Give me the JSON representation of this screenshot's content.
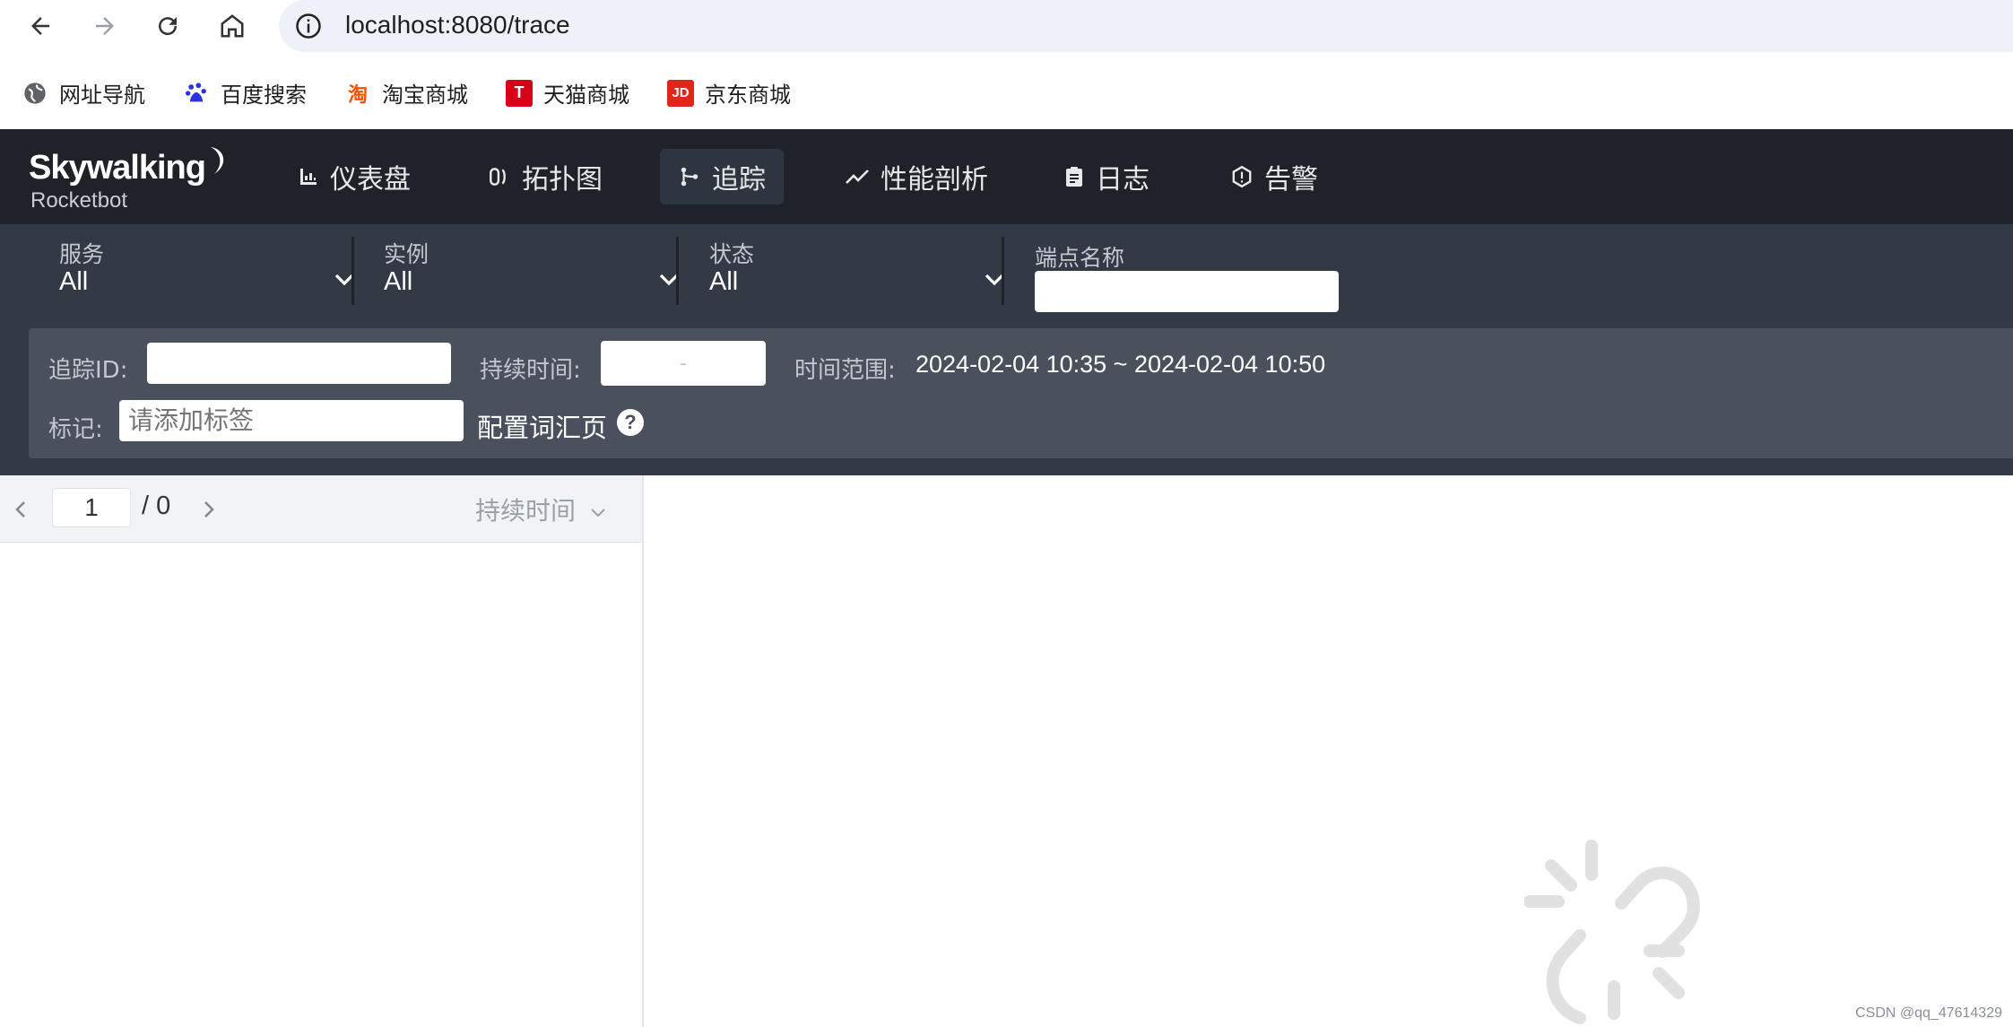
{
  "browser": {
    "url": "localhost:8080/trace",
    "bookmarks": [
      {
        "label": "网址导航",
        "icon": "globe-icon"
      },
      {
        "label": "百度搜索",
        "icon": "baidu-icon"
      },
      {
        "label": "淘宝商城",
        "icon": "taobao-icon",
        "glyph": "淘"
      },
      {
        "label": "天猫商城",
        "icon": "tmall-icon",
        "glyph": "T"
      },
      {
        "label": "京东商城",
        "icon": "jd-icon",
        "glyph": "JD"
      }
    ]
  },
  "app": {
    "logo": "Skywalking",
    "logo_sub": "Rocketbot",
    "nav": [
      {
        "label": "仪表盘",
        "icon": "dashboard-icon"
      },
      {
        "label": "拓扑图",
        "icon": "topology-icon"
      },
      {
        "label": "追踪",
        "icon": "trace-icon",
        "active": true
      },
      {
        "label": "性能剖析",
        "icon": "profile-icon"
      },
      {
        "label": "日志",
        "icon": "log-icon"
      },
      {
        "label": "告警",
        "icon": "alarm-icon"
      }
    ]
  },
  "filters": {
    "service": {
      "label": "服务",
      "value": "All"
    },
    "instance": {
      "label": "实例",
      "value": "All"
    },
    "status": {
      "label": "状态",
      "value": "All"
    },
    "endpoint": {
      "label": "端点名称",
      "value": ""
    }
  },
  "panel": {
    "trace_id_label": "追踪ID:",
    "duration_label": "持续时间:",
    "duration_sep": "-",
    "time_range_label": "时间范围:",
    "time_range_value": "2024-02-04 10:35 ~ 2024-02-04 10:50",
    "tags_label": "标记:",
    "tags_placeholder": "请添加标签",
    "config_link": "配置词汇页",
    "help_glyph": "?"
  },
  "list": {
    "page": "1",
    "total": "/ 0",
    "sort_label": "持续时间"
  },
  "watermark": "CSDN @qq_47614329"
}
